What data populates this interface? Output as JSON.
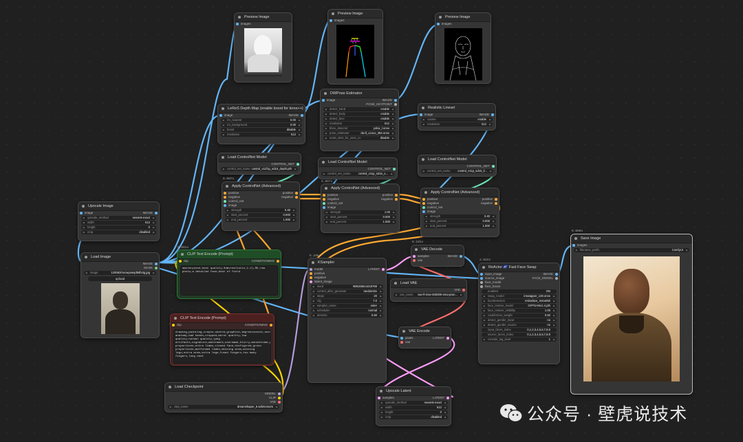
{
  "nodes": {
    "preview1": {
      "title": "Preview Image",
      "in": "images"
    },
    "preview2": {
      "title": "Preview Image",
      "in": "images"
    },
    "preview3": {
      "title": "Preview Image",
      "in": "images"
    },
    "leres": {
      "title": "LeReS Depth Map (enable boost for leres++)",
      "in": "image",
      "out": "IMAGE",
      "widgets": [
        [
          "rm_nearest",
          "0.00"
        ],
        [
          "rm_background",
          "0.00"
        ],
        [
          "boost",
          "disable"
        ],
        [
          "resolution",
          "512"
        ]
      ]
    },
    "dwpose": {
      "title": "DWPose Estimator",
      "in": "image",
      "out1": "IMAGE",
      "out2": "POSE_KEYPOINT",
      "widgets": [
        [
          "detect_hand",
          "enable"
        ],
        [
          "detect_body",
          "enable"
        ],
        [
          "detect_face",
          "enable"
        ],
        [
          "resolution",
          "512"
        ],
        [
          "bbox_detector",
          "yolox_l.onnx"
        ],
        [
          "pose_estimator",
          "dw-ll_ucoco_384.onnx"
        ],
        [
          "scale_stick_for_xinsr_cn",
          "disable"
        ]
      ]
    },
    "lineart": {
      "title": "Realistic Lineart",
      "in": "image",
      "out": "IMAGE",
      "widgets": [
        [
          "coarse",
          "enable"
        ],
        [
          "resolution",
          "512"
        ]
      ]
    },
    "cnload1": {
      "title": "Load ControlNet Model",
      "out": "CONTROL_NET",
      "widgets": [
        [
          "control_net_name",
          "control_v11f1p_sd15_depth.pth"
        ]
      ]
    },
    "cnload2": {
      "title": "Load ControlNet Model",
      "out": "CONTROL_NET",
      "widgets": [
        [
          "control_net_name",
          "control_v11p_sd15_o..."
        ]
      ]
    },
    "cnload3": {
      "title": "Load ControlNet Model",
      "out": "CONTROL_NET",
      "widgets": [
        [
          "control_net_name",
          "control_v11p_sd15_li..."
        ]
      ]
    },
    "apply1": {
      "badge": "0.607s",
      "title": "Apply ControlNet (Advanced)",
      "ins": [
        "positive",
        "negative",
        "control_net",
        "image"
      ],
      "outs": [
        "positive",
        "negative"
      ],
      "widgets": [
        [
          "strength",
          "0.40"
        ],
        [
          "start_percent",
          "0.000"
        ],
        [
          "end_percent",
          "1.000"
        ]
      ]
    },
    "apply2": {
      "badge": "0.007s",
      "title": "Apply ControlNet (Advanced)",
      "ins": [
        "positive",
        "negative",
        "control_net",
        "image"
      ],
      "outs": [
        "positive",
        "negative"
      ],
      "widgets": [
        [
          "strength",
          "1.00"
        ],
        [
          "start_percent",
          "0.000"
        ],
        [
          "end_percent",
          "1.000"
        ]
      ]
    },
    "apply3": {
      "title": "Apply ControlNet (Advanced)",
      "ins": [
        "positive",
        "negative",
        "control_net",
        "image"
      ],
      "outs": [
        "positive",
        "negative"
      ],
      "widgets": [
        [
          "strength",
          "0.40"
        ],
        [
          "start_percent",
          "0.000"
        ],
        [
          "end_percent",
          "1.000"
        ]
      ]
    },
    "upscale_image": {
      "title": "Upscale Image",
      "in": "image",
      "out": "IMAGE",
      "widgets": [
        [
          "upscale_method",
          "nearest-exact"
        ],
        [
          "width",
          "512"
        ],
        [
          "height",
          "0"
        ],
        [
          "crop",
          "disabled"
        ]
      ]
    },
    "load_image": {
      "title": "Load Image",
      "out1": "IMAGE",
      "out2": "MASK",
      "widgets": [
        [
          "image",
          "120062/nocwposejd9dfv3g.jpg"
        ]
      ],
      "upload": "upload"
    },
    "clip_pos": {
      "badge": "0.001s",
      "title": "CLIP Text Encode (Prompt)",
      "in": "clip",
      "out": "CONDITIONING",
      "text": "masterpiece,best quality,3dmvrealistic,1.2),RE,raw photo,a detailed face,best of field"
    },
    "clip_neg": {
      "title": "CLIP Text Encode (Prompt)",
      "in": "clip",
      "out": "CONDITIONING",
      "text": "drawing,painting,crayon,sketch,graphite,impressionist,noisy,blurry,soft,deformed,ugly,lowres,bad anatomy,bad hands,cropped,worst quality,low quality,normal quality,jpeg artifacts,signature,watermark,username,blurry,monochrome,grayscale,bad proportions,extra limbs,cloned face,disfigured,gross proportions,malformed limbs,missing arms,missing legs,extra arms,extra legs,fused fingers,too many fingers,long neck"
    },
    "load_ckpt": {
      "title": "Load Checkpoint",
      "out1": "MODEL",
      "out2": "CLIP",
      "out3": "VAE",
      "widgets": [
        [
          "ckpt_name",
          "dreamshaper_8.safetensors"
        ]
      ]
    },
    "ksampler": {
      "badge": "6.288s",
      "title": "KSampler",
      "ins": [
        "model",
        "positive",
        "negative",
        "latent_image"
      ],
      "out": "LATENT",
      "widgets": [
        [
          "seed",
          "989165614419769"
        ],
        [
          "control_after_generate",
          "randomize"
        ],
        [
          "steps",
          "20"
        ],
        [
          "cfg",
          "7.0"
        ],
        [
          "sampler_name",
          "euler"
        ],
        [
          "scheduler",
          "normal"
        ],
        [
          "denoise",
          "0.60"
        ]
      ]
    },
    "vae_decode": {
      "badge": "0.181s",
      "title": "VAE Decode",
      "ins": [
        "samples",
        "vae"
      ],
      "out": "IMAGE"
    },
    "load_vae": {
      "title": "Load VAE",
      "out": "VAE",
      "widgets": [
        [
          "vae_name",
          "vae-ft-mse-840000-ema-prun..."
        ]
      ]
    },
    "vae_encode": {
      "title": "VAE Encode",
      "ins": [
        "pixels",
        "vae"
      ],
      "out": "LATENT"
    },
    "upscale_latent": {
      "title": "Upscale Latent",
      "in": "samples",
      "out": "LATENT",
      "widgets": [
        [
          "upscale_method",
          "nearest-exact"
        ],
        [
          "width",
          "512"
        ],
        [
          "height",
          "0"
        ],
        [
          "crop",
          "disabled"
        ]
      ]
    },
    "reactor": {
      "badge": "2.022s",
      "title": "ReActor 🌌 Fast Face Swap",
      "ins": [
        "input_image",
        "source_image",
        "face_model",
        "face_boost"
      ],
      "out1": "IMAGE",
      "out2": "FACE_MODEL",
      "widgets": [
        [
          "enabled",
          "ON"
        ],
        [
          "swap_model",
          "inswapper_128.onnx"
        ],
        [
          "facedetection",
          "retinaface_resnet50"
        ],
        [
          "face_restore_model",
          "GFPGANv1.4.pth"
        ],
        [
          "face_restore_visibility",
          "1.00"
        ],
        [
          "codeformer_weight",
          "0.50"
        ],
        [
          "detect_gender_input",
          "no"
        ],
        [
          "detect_gender_source",
          "no"
        ],
        [
          "input_faces_index",
          "0,1,2,3,4,5,6,7,8,9"
        ],
        [
          "source_faces_index",
          "0,1,2,3,4,5,6,7,8,9"
        ],
        [
          "console_log_level",
          "1"
        ]
      ]
    },
    "save_image": {
      "badge": "0.080s",
      "title": "Save Image",
      "in": "images",
      "widgets": [
        [
          "filename_prefix",
          "ComfyUI"
        ]
      ]
    }
  },
  "watermark": {
    "text": "公众号 · 壁虎说技术",
    "icon": "wechat-icon"
  },
  "colors": {
    "image": "#64b5f6",
    "conditioning": "#ffa931",
    "control_net": "#6ee7b7",
    "model": "#b39ddb",
    "clip": "#ffd500",
    "vae": "#ff6e6e",
    "latent": "#ff9cf9"
  }
}
